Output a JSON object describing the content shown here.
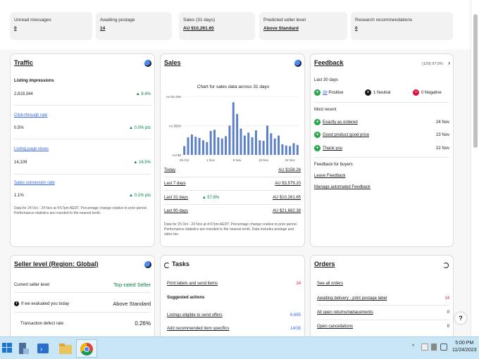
{
  "stats": [
    {
      "title": "Unread messages",
      "value": "0"
    },
    {
      "title": "Awaiting postage",
      "value": "14"
    },
    {
      "title": "Sales (31 days)",
      "value": "AU $10,261.65"
    },
    {
      "title": "Predicted seller level",
      "value": "Above Standard"
    },
    {
      "title": "Research recommendations",
      "value": "0"
    }
  ],
  "traffic": {
    "title": "Traffic",
    "impressions_label": "Listing impressions",
    "impressions_value": "2,819,344",
    "impressions_change": "▲ 8.4%",
    "ctr_label": "Click-through rate",
    "ctr_value": "0.5%",
    "ctr_change": "▲ 0.0% pts",
    "views_label": "Listing page views",
    "views_value": "14,109",
    "views_change": "▲ 16.5%",
    "conv_label": "Sales conversion rate",
    "conv_value": "1.1%",
    "conv_change": "▲ 0.1% pts",
    "note": "Data for 24 Oct - 24 Nov at 4:57pm AEDT. Percentage change relative to prior period. Performance statistics are rounded to the nearest tenth."
  },
  "sales": {
    "title": "Sales",
    "rows": [
      {
        "label": "Today",
        "value": "AU $158.26",
        "change": ""
      },
      {
        "label": "Last 7 days",
        "value": "AU $3,579.20",
        "change": ""
      },
      {
        "label": "Last 31 days",
        "value": "AU $10,261.65",
        "change": "▲ 57.8%"
      },
      {
        "label": "Last 90 days",
        "value": "AU $21,682.38",
        "change": ""
      }
    ],
    "note": "Data for 25 Oct - 24 Nov at 4:57pm AEDT. Percentage change relative to prior period. Performance statistics are rounded to the nearest tenth. Data includes postage and sales tax."
  },
  "chart_data": {
    "type": "bar",
    "title": "Chart for sales data across 31 days",
    "ylabel": "",
    "xlabel": "",
    "ylim": [
      0,
      1000
    ],
    "y_ticks": [
      "AU $1,000",
      "AU $500",
      "AU $0"
    ],
    "x_ticks": [
      "25 Oct",
      "1 Nov",
      "8 Nov",
      "15 Nov",
      "22 Nov"
    ],
    "values": [
      150,
      300,
      350,
      310,
      290,
      250,
      220,
      410,
      430,
      300,
      280,
      320,
      500,
      900,
      700,
      450,
      330,
      380,
      300,
      420,
      250,
      240,
      500,
      370,
      280,
      330,
      180,
      160,
      150,
      200,
      170
    ],
    "color": "#5b7fc7"
  },
  "feedback": {
    "title": "Feedback",
    "score": "(129) 97.5%",
    "period": "Last 30 days",
    "positive_count": "38",
    "positive_label": "Positive",
    "neutral": "1 Neutral",
    "negative": "0 Negative",
    "recent_label": "Most recent",
    "recent": [
      {
        "text": "Exactly as ordered",
        "date": "24 Nov"
      },
      {
        "text": "Good product good price",
        "date": "23 Nov"
      },
      {
        "text": "Thank you",
        "date": "22 Nov"
      }
    ],
    "buyers_label": "Feedback for buyers",
    "leave": "Leave Feedback",
    "manage": "Manage automated Feedback"
  },
  "seller_level": {
    "title": "Seller level (Region: Global)",
    "current_label": "Current seller level",
    "current_value": "Top-rated Seller",
    "eval_label": "If we evaluated you today",
    "eval_value": "Above Standard",
    "defect_label": "Transaction defect rate",
    "defect_value": "0.26%"
  },
  "tasks": {
    "title": "Tasks",
    "print_label": "Print labels and send items",
    "print_count": "14",
    "suggested": "Suggested actions",
    "offers_label": "Listings eligible to send offers",
    "offers_count": "6,665",
    "specifics_label": "Add recommended item specifics",
    "specifics_count": "14/38"
  },
  "orders": {
    "title": "Orders",
    "see_all": "See all orders",
    "rows": [
      {
        "label": "Awaiting delivery - print postage label",
        "count": "14"
      },
      {
        "label": "All open returns/replacements",
        "count": "0"
      },
      {
        "label": "Open cancellations",
        "count": "0"
      }
    ]
  },
  "taskbar": {
    "time": "5:00 PM",
    "date": "11/24/2023"
  },
  "help": "?"
}
